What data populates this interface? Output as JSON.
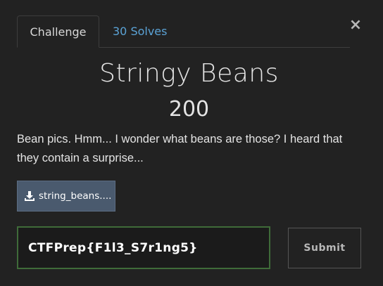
{
  "tabs": {
    "challenge_label": "Challenge",
    "solves_label": "30 Solves"
  },
  "close_label": "×",
  "challenge": {
    "name": "Stringy Beans",
    "points": "200",
    "description": "Bean pics. Hmm... I wonder what beans are those? I heard that they contain a surprise...",
    "file_label": "string_beans...."
  },
  "flag": {
    "value": "CTFPrep{F1l3_S7r1ng5}",
    "placeholder": "Flag"
  },
  "submit_label": "Submit",
  "icons": {
    "download": "download-icon",
    "close": "close-icon"
  },
  "colors": {
    "background": "#222222",
    "accent_link": "#5ba3d6",
    "file_button": "#4a5a6e",
    "input_border_valid": "#3f6b39"
  }
}
